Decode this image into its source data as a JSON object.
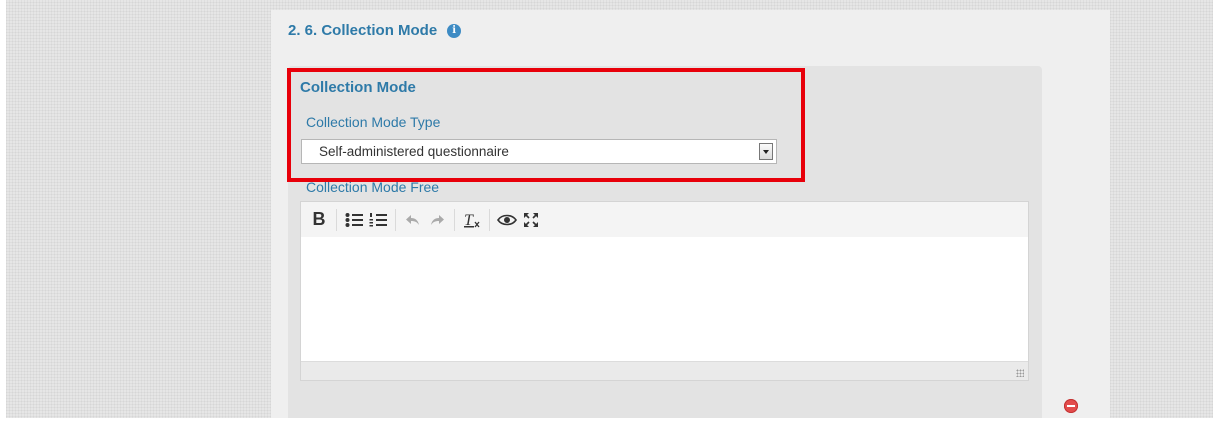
{
  "section": {
    "number_title": "2. 6. Collection Mode",
    "info_icon": "info-icon"
  },
  "group": {
    "title": "Collection Mode"
  },
  "type_field": {
    "label": "Collection Mode Type",
    "selected_value": "Self-administered questionnaire"
  },
  "free_field": {
    "label": "Collection Mode Free",
    "toolbar": [
      "bold-icon",
      "bulleted-list-icon",
      "numbered-list-icon",
      "undo-icon",
      "redo-icon",
      "remove-format-icon",
      "preview-icon",
      "maximize-icon"
    ],
    "bold_label": "B",
    "content": ""
  },
  "colors": {
    "accent": "#2e7aa8",
    "highlight": "#e8000a",
    "remove": "#e34c4c"
  }
}
